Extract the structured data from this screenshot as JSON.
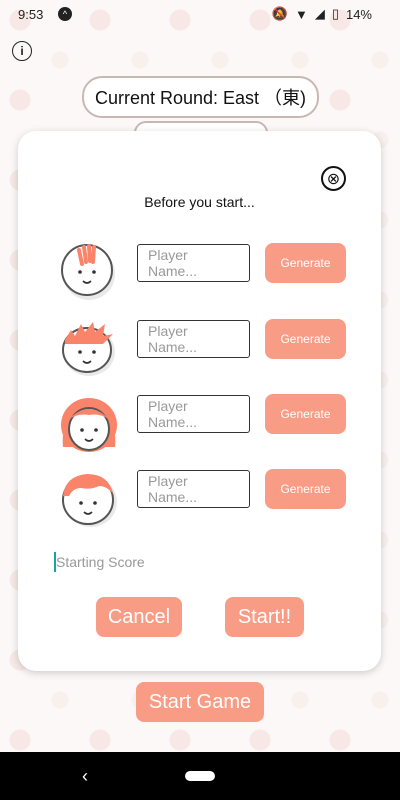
{
  "status_bar": {
    "time": "9:53",
    "app_icon": "expo-icon",
    "battery": "14%",
    "icons": [
      "notifications-off-icon",
      "wifi-icon",
      "signal-icon",
      "battery-icon"
    ]
  },
  "header": {
    "info_icon": "i",
    "round_label": "Current Round: East （東)"
  },
  "dialog": {
    "title": "Before you start...",
    "close_icon": "⊗",
    "players": [
      {
        "placeholder": "Player Name...",
        "generate_label": "Generate",
        "avatar": "avatar-1"
      },
      {
        "placeholder": "Player Name...",
        "generate_label": "Generate",
        "avatar": "avatar-2"
      },
      {
        "placeholder": "Player Name...",
        "generate_label": "Generate",
        "avatar": "avatar-3"
      },
      {
        "placeholder": "Player Name...",
        "generate_label": "Generate",
        "avatar": "avatar-4"
      }
    ],
    "starting_score_placeholder": "Starting Score",
    "cancel_label": "Cancel",
    "start_label": "Start!!"
  },
  "footer": {
    "start_game_label": "Start Game"
  },
  "colors": {
    "accent": "#f99c86",
    "hair": "#f9846a",
    "dialog_bg": "#ffffff"
  }
}
